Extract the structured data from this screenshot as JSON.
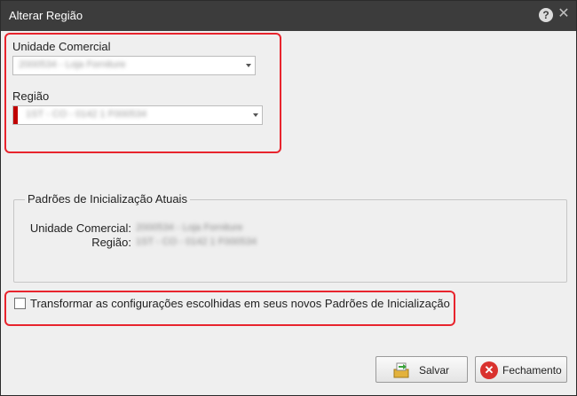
{
  "window": {
    "title": "Alterar Região"
  },
  "form": {
    "unidade_label": "Unidade Comercial",
    "unidade_value": "2000534 - Loja Forniture",
    "regiao_label": "Região",
    "regiao_value": "1ST - CO - 0142 1 F000534"
  },
  "defaults": {
    "title": "Padrões de Inicialização Atuais",
    "unidade_label": "Unidade Comercial:",
    "unidade_value": "2000534 - Loja Forniture",
    "regiao_label": "Região:",
    "regiao_value": "1ST - CO - 0142 1 F000534"
  },
  "checkbox": {
    "label": "Transformar as configurações escolhidas em seus novos Padrões de Inicialização",
    "checked": false
  },
  "buttons": {
    "save": "Salvar",
    "close": "Fechamento"
  },
  "icons": {
    "help": "help-icon",
    "close": "close-icon",
    "save": "save-icon",
    "cancel": "cancel-icon"
  },
  "colors": {
    "titlebar": "#3c3c3c",
    "highlight": "#e8242d",
    "required": "#c00000"
  }
}
